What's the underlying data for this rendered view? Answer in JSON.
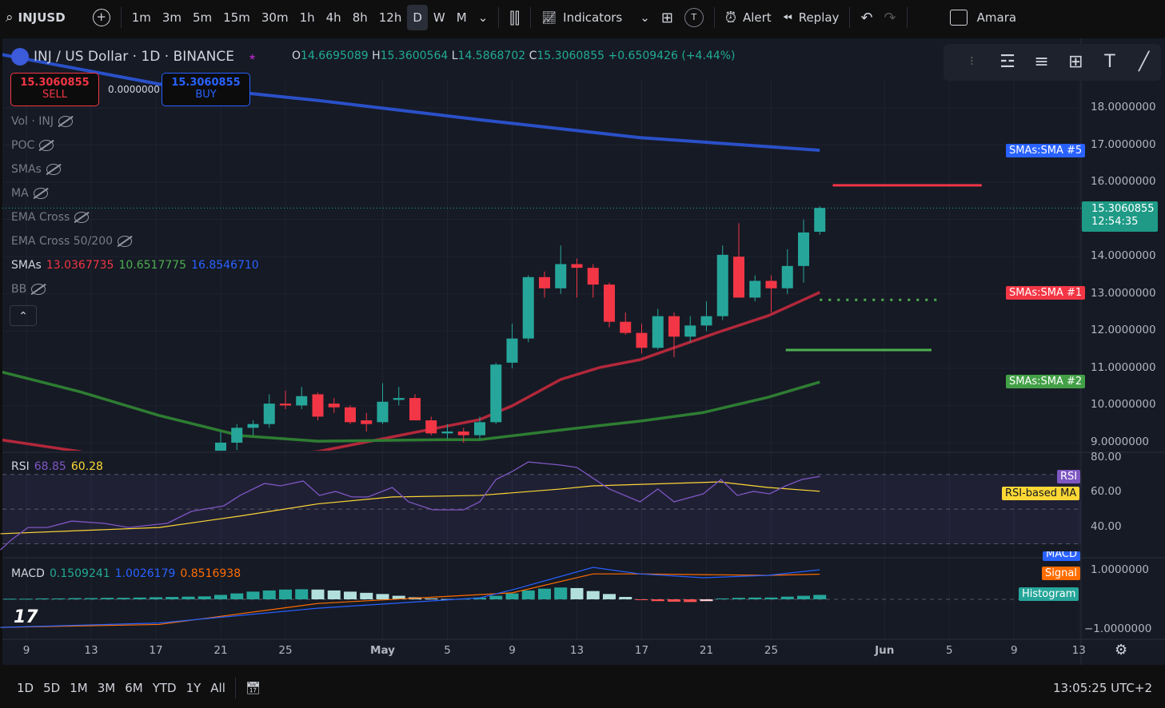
{
  "toolbar": {
    "symbol": "INJUSD",
    "intervals": [
      "1m",
      "3m",
      "5m",
      "15m",
      "30m",
      "1h",
      "4h",
      "8h",
      "12h",
      "D",
      "W",
      "M"
    ],
    "active_interval": "D",
    "indicators": "Indicators",
    "alert": "Alert",
    "replay": "Replay",
    "user": "Amara",
    "t_badge": "T"
  },
  "header": {
    "title": "INJ / US Dollar · 1D · BINANCE",
    "o_label": "O",
    "o": "14.6695089",
    "h_label": "H",
    "h": "15.3600564",
    "l_label": "L",
    "l": "14.5868702",
    "c_label": "C",
    "c": "15.3060855",
    "change": "+0.6509426 (+4.44%)"
  },
  "trade": {
    "sell_price": "15.3060855",
    "sell": "SELL",
    "spread": "0.0000000",
    "buy_price": "15.3060855",
    "buy": "BUY"
  },
  "legend": [
    {
      "name": "Vol · INJ"
    },
    {
      "name": "POC"
    },
    {
      "name": "SMAs"
    },
    {
      "name": "MA"
    },
    {
      "name": "EMA Cross"
    },
    {
      "name": "EMA Cross 50/200"
    }
  ],
  "smas_legend": {
    "name": "SMAs",
    "v1": "13.0367735",
    "v2": "10.6517775",
    "v3": "16.8546710"
  },
  "bb_legend": "BB",
  "rsi_legend": {
    "name": "RSI",
    "v1": "68.85",
    "v2": "60.28"
  },
  "macd_legend": {
    "name": "MACD",
    "v1": "0.1509241",
    "v2": "1.0026179",
    "v3": "0.8516938"
  },
  "price_axis": [
    "18.0000000",
    "17.0000000",
    "16.0000000",
    "14.0000000",
    "13.0000000",
    "12.0000000",
    "11.0000000",
    "10.0000000",
    "9.0000000"
  ],
  "current_price": {
    "value": "15.3060855",
    "countdown": "12:54:35"
  },
  "tags": {
    "sma5": "SMAs:SMA #5",
    "sma1": "SMAs:SMA #1",
    "sma2": "SMAs:SMA #2",
    "rsi": "RSI",
    "rsi_ma": "RSI-based MA",
    "macd": "MACD",
    "signal": "Signal",
    "hist": "Histogram"
  },
  "rsi_axis": [
    "80.00",
    "60.00",
    "40.00"
  ],
  "macd_axis": [
    "1.0000000",
    "−1.0000000"
  ],
  "time_axis": [
    {
      "d": 0,
      "t": "9"
    },
    {
      "d": 4,
      "t": "13"
    },
    {
      "d": 8,
      "t": "17"
    },
    {
      "d": 12,
      "t": "21"
    },
    {
      "d": 16,
      "t": "25"
    },
    {
      "d": 22,
      "t": "May"
    },
    {
      "d": 26,
      "t": "5"
    },
    {
      "d": 30,
      "t": "9"
    },
    {
      "d": 34,
      "t": "13"
    },
    {
      "d": 38,
      "t": "17"
    },
    {
      "d": 42,
      "t": "21"
    },
    {
      "d": 46,
      "t": "25"
    },
    {
      "d": 53,
      "t": "Jun"
    },
    {
      "d": 57,
      "t": "5"
    },
    {
      "d": 61,
      "t": "9"
    },
    {
      "d": 65,
      "t": "13"
    }
  ],
  "bottom": {
    "ranges": [
      "1D",
      "5D",
      "1M",
      "3M",
      "6M",
      "YTD",
      "1Y",
      "All"
    ],
    "clock": "13:05:25 UTC+2"
  },
  "colors": {
    "up": "#26a69a",
    "down": "#f23645",
    "sma5": "#2a50c8",
    "sma1": "#b2283a",
    "sma2": "#2e7d32"
  },
  "chart_data": {
    "type": "candlestick",
    "x_unit": "days since Apr 9",
    "candles": [
      [
        12,
        8.7,
        9.3,
        8.6,
        9.0
      ],
      [
        13,
        9.0,
        9.5,
        8.8,
        9.4
      ],
      [
        14,
        9.4,
        9.6,
        9.2,
        9.5
      ],
      [
        15,
        9.5,
        10.3,
        9.4,
        10.05
      ],
      [
        16,
        10.05,
        10.4,
        9.9,
        10.0
      ],
      [
        17,
        10.0,
        10.5,
        9.9,
        10.25
      ],
      [
        18,
        10.3,
        10.35,
        9.6,
        9.7
      ],
      [
        19,
        10.05,
        10.2,
        9.8,
        9.95
      ],
      [
        20,
        9.95,
        10.0,
        9.5,
        9.55
      ],
      [
        21,
        9.6,
        9.8,
        9.3,
        9.5
      ],
      [
        22,
        9.55,
        10.6,
        9.5,
        10.1
      ],
      [
        23,
        10.15,
        10.5,
        10.0,
        10.2
      ],
      [
        24,
        10.2,
        10.3,
        9.6,
        9.6
      ],
      [
        25,
        9.6,
        9.7,
        9.2,
        9.25
      ],
      [
        26,
        9.25,
        9.5,
        9.1,
        9.3
      ],
      [
        27,
        9.3,
        9.4,
        9.0,
        9.2
      ],
      [
        28,
        9.2,
        9.7,
        9.1,
        9.55
      ],
      [
        29,
        9.55,
        11.15,
        9.5,
        11.1
      ],
      [
        30,
        11.15,
        12.2,
        11.0,
        11.8
      ],
      [
        31,
        11.8,
        13.5,
        11.7,
        13.45
      ],
      [
        32,
        13.45,
        13.6,
        12.9,
        13.15
      ],
      [
        33,
        13.15,
        14.3,
        13.0,
        13.8
      ],
      [
        34,
        13.8,
        13.95,
        12.9,
        13.7
      ],
      [
        35,
        13.7,
        13.8,
        12.9,
        13.25
      ],
      [
        36,
        13.25,
        13.3,
        12.1,
        12.25
      ],
      [
        37,
        12.25,
        12.5,
        11.9,
        11.95
      ],
      [
        38,
        11.95,
        12.2,
        11.4,
        11.55
      ],
      [
        39,
        11.55,
        12.6,
        11.5,
        12.4
      ],
      [
        40,
        12.4,
        12.5,
        11.3,
        11.85
      ],
      [
        41,
        11.85,
        12.4,
        11.7,
        12.15
      ],
      [
        42,
        12.15,
        12.8,
        12.0,
        12.4
      ],
      [
        43,
        12.4,
        14.3,
        12.3,
        14.05
      ],
      [
        44,
        14.0,
        14.9,
        12.9,
        12.9
      ],
      [
        45,
        12.9,
        13.5,
        12.8,
        13.35
      ],
      [
        46,
        13.35,
        13.5,
        12.5,
        13.15
      ],
      [
        47,
        13.15,
        14.2,
        13.0,
        13.75
      ],
      [
        48,
        13.75,
        15.0,
        13.3,
        14.65
      ],
      [
        49,
        14.67,
        15.36,
        14.59,
        15.31
      ]
    ],
    "candle_format": [
      "day",
      "open",
      "high",
      "low",
      "close"
    ],
    "sma5": [
      [
        -1.6,
        19.44
      ],
      [
        8.2,
        18.64
      ],
      [
        18,
        18.2
      ],
      [
        28,
        17.68
      ],
      [
        37.9,
        17.2
      ],
      [
        49,
        16.86
      ]
    ],
    "sma1": [
      [
        -1.6,
        9.08
      ],
      [
        8.2,
        8.44
      ],
      [
        18,
        8.76
      ],
      [
        23,
        9.19
      ],
      [
        28,
        9.62
      ],
      [
        30,
        9.99
      ],
      [
        33,
        10.7
      ],
      [
        35.4,
        11.02
      ],
      [
        37.9,
        11.23
      ],
      [
        42.8,
        11.98
      ],
      [
        45.8,
        12.41
      ],
      [
        49,
        13.04
      ]
    ],
    "sma2": [
      [
        -1.6,
        10.91
      ],
      [
        3.3,
        10.37
      ],
      [
        8.2,
        9.73
      ],
      [
        13.2,
        9.19
      ],
      [
        18,
        9.04
      ],
      [
        25.5,
        9.08
      ],
      [
        28,
        9.08
      ],
      [
        33,
        9.34
      ],
      [
        37.9,
        9.58
      ],
      [
        41.8,
        9.81
      ],
      [
        45.8,
        10.22
      ],
      [
        49,
        10.63
      ]
    ],
    "hlines": [
      {
        "from": 49.8,
        "to": 59,
        "value": 15.92,
        "color": "#f23645",
        "style": "solid"
      },
      {
        "from": 49,
        "to": 56.6,
        "value": 12.84,
        "color": "#4caf50",
        "style": "dotted"
      },
      {
        "from": 46.9,
        "to": 55.9,
        "value": 11.49,
        "color": "#4caf50",
        "style": "solid"
      }
    ],
    "ylim": [
      8.6,
      19.5
    ],
    "rsi": [
      [
        -1.6,
        26.5
      ],
      [
        -0.9,
        32.5
      ],
      [
        0.1,
        39.4
      ],
      [
        1.3,
        39.4
      ],
      [
        2.8,
        43.1
      ],
      [
        4.8,
        41.8
      ],
      [
        6.3,
        39.4
      ],
      [
        8.7,
        41.8
      ],
      [
        10.2,
        48.7
      ],
      [
        12.2,
        51.9
      ],
      [
        13.2,
        57.9
      ],
      [
        14.7,
        64.8
      ],
      [
        15.7,
        63.4
      ],
      [
        17.1,
        66.2
      ],
      [
        18.1,
        57.9
      ],
      [
        19.1,
        60.2
      ],
      [
        20.1,
        57
      ],
      [
        21.1,
        57
      ],
      [
        22.6,
        62.5
      ],
      [
        23.6,
        54.2
      ],
      [
        25.1,
        49.6
      ],
      [
        27,
        49.6
      ],
      [
        28,
        54.2
      ],
      [
        29,
        67.1
      ],
      [
        30,
        71.7
      ],
      [
        31,
        77.2
      ],
      [
        33,
        75.4
      ],
      [
        34,
        74
      ],
      [
        36,
        61.6
      ],
      [
        37.9,
        54.2
      ],
      [
        39,
        61.6
      ],
      [
        40,
        54.2
      ],
      [
        41.8,
        58.8
      ],
      [
        42.9,
        67.1
      ],
      [
        43.9,
        57.9
      ],
      [
        44.9,
        60.2
      ],
      [
        45.9,
        58.8
      ],
      [
        46.9,
        63.4
      ],
      [
        47.9,
        67.1
      ],
      [
        49,
        68.85
      ]
    ],
    "rsi_ma": [
      [
        -1.6,
        35.8
      ],
      [
        8.2,
        39.4
      ],
      [
        13.2,
        46
      ],
      [
        18,
        53
      ],
      [
        22.6,
        57
      ],
      [
        28,
        57.9
      ],
      [
        33,
        61.6
      ],
      [
        35,
        63.4
      ],
      [
        42.8,
        65.7
      ],
      [
        45.8,
        62.5
      ],
      [
        49,
        60.28
      ]
    ],
    "rsi_bands": [
      70,
      50,
      30
    ],
    "macd": [
      [
        -1.6,
        -0.95
      ],
      [
        8.2,
        -0.8
      ],
      [
        18,
        -0.3
      ],
      [
        28,
        0.05
      ],
      [
        30,
        0.32
      ],
      [
        35,
        1.08
      ],
      [
        37.9,
        0.86
      ],
      [
        41.8,
        0.73
      ],
      [
        45.8,
        0.81
      ],
      [
        49,
        1.0
      ]
    ],
    "signal": [
      [
        -1.6,
        -0.95
      ],
      [
        8.2,
        -0.85
      ],
      [
        18,
        -0.14
      ],
      [
        30,
        0.22
      ],
      [
        35,
        0.86
      ],
      [
        37.9,
        0.86
      ],
      [
        45.8,
        0.81
      ],
      [
        49,
        0.85
      ]
    ],
    "histogram": [
      0.02,
      0.02,
      0.03,
      0.03,
      0.04,
      0.04,
      0.05,
      0.05,
      0.06,
      0.07,
      0.08,
      0.09,
      0.1,
      0.15,
      0.2,
      0.26,
      0.3,
      0.33,
      0.34,
      0.33,
      0.3,
      0.26,
      0.22,
      0.18,
      0.12,
      0.07,
      0.03,
      0.01,
      0.02,
      0.06,
      0.12,
      0.2,
      0.3,
      0.36,
      0.4,
      0.38,
      0.28,
      0.18,
      0.08,
      -0.02,
      -0.06,
      -0.08,
      -0.09,
      -0.06,
      0.03,
      0.05,
      0.06,
      0.06,
      0.09,
      0.12,
      0.15
    ],
    "hist_start_day": -1,
    "macd_ylim": [
      -1.0,
      1.0
    ]
  }
}
